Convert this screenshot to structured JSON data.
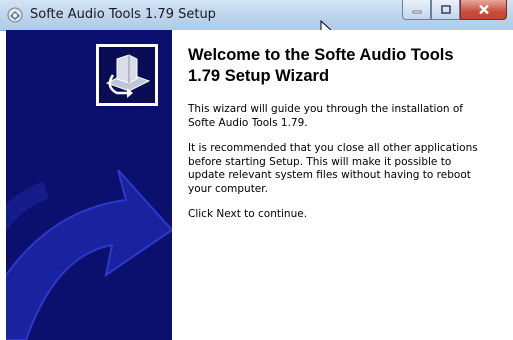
{
  "window": {
    "title": "Softe Audio Tools 1.79 Setup",
    "icons": {
      "app": "setup-app-icon",
      "minimize": "minimize-icon",
      "maximize": "maximize-icon",
      "close": "close-icon"
    }
  },
  "wizard": {
    "heading": "Welcome to the Softe Audio Tools 1.79 Setup Wizard",
    "intro": "This wizard will guide you through the installation of Softe Audio Tools 1.79.",
    "recommendation": "It is recommended that you close all other applications before starting Setup. This will make it possible to update relevant system files without having to reboot your computer.",
    "continue_hint": "Click Next to continue."
  },
  "colors": {
    "sidebar": "#0b0f6e",
    "titlebar": "#bcd3ec",
    "close_button": "#c7503c"
  }
}
